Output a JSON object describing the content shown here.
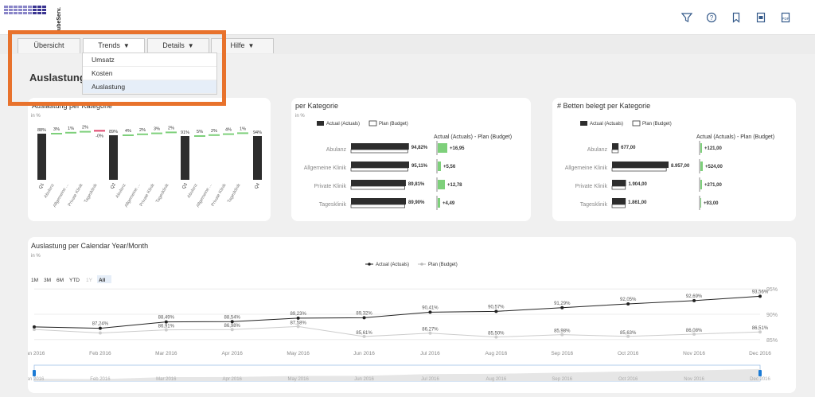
{
  "app": {
    "logo_text": "ubeServ."
  },
  "tabs": [
    {
      "label": "Übersicht"
    },
    {
      "label": "Trends"
    },
    {
      "label": "Details"
    },
    {
      "label": "Hilfe"
    }
  ],
  "dropdown": {
    "items": [
      "Umsatz",
      "Kosten",
      "Auslastung"
    ],
    "selected": "Auslastung"
  },
  "page": {
    "title": "Auslastungsa"
  },
  "cards": {
    "left": {
      "title": "Auslastung per Kategorie",
      "unit": "in %",
      "bar_labels": [
        "88%",
        "89%",
        "91%",
        "94%"
      ],
      "quarters": [
        "Q1",
        "Q2",
        "Q3",
        "Q4"
      ],
      "steps": [
        [
          "3%",
          "1%",
          "2%",
          "-0%"
        ],
        [
          "4%",
          "2%",
          "3%",
          "2%"
        ],
        [
          "5%",
          "2%",
          "4%",
          "1%"
        ]
      ],
      "categories": [
        "Abulanz",
        "Allgemeine ...",
        "Private Klinik",
        "Tagesklinik"
      ]
    },
    "middle": {
      "title": "per Kategorie",
      "unit": "in %",
      "legend": [
        "Actual (Actuals)",
        "Plan (Budget)"
      ],
      "variance_title": "Actual (Actuals) - Plan (Budget)",
      "rows": [
        {
          "label": "Abulanz",
          "actual": 94.82,
          "value": "94,82%",
          "delta": "+16,95"
        },
        {
          "label": "Allgemeine Klinik",
          "actual": 95.11,
          "value": "95,11%",
          "delta": "+5,56"
        },
        {
          "label": "Private Klinik",
          "actual": 89.81,
          "value": "89,81%",
          "delta": "+12,78"
        },
        {
          "label": "Tagesklinik",
          "actual": 89.9,
          "value": "89,90%",
          "delta": "+4,49"
        }
      ]
    },
    "right": {
      "title": "# Betten belegt per Kategorie",
      "legend": [
        "Actual (Actuals)",
        "Plan (Budget)"
      ],
      "variance_title": "Actual (Actuals) - Plan (Budget)",
      "rows": [
        {
          "label": "Abulanz",
          "actual": 677,
          "value": "677,00",
          "delta": "+121,00"
        },
        {
          "label": "Allgemeine Klinik",
          "actual": 8957,
          "value": "8.957,00",
          "delta": "+524,00"
        },
        {
          "label": "Private Klinik",
          "actual": 1904,
          "value": "1.904,00",
          "delta": "+271,00"
        },
        {
          "label": "Tagesklinik",
          "actual": 1861,
          "value": "1.861,00",
          "delta": "+93,00"
        }
      ]
    }
  },
  "line_card": {
    "title": "Auslastung per Calendar Year/Month",
    "unit": "in %",
    "range_buttons": [
      "1M",
      "3M",
      "6M",
      "YTD",
      "1Y",
      "All"
    ],
    "active_range": "All"
  },
  "chart_data": {
    "type": "line",
    "x": [
      "Jan 2016",
      "Feb 2016",
      "Mar 2016",
      "Apr 2016",
      "May 2016",
      "Jun 2016",
      "Jul 2016",
      "Aug 2016",
      "Sep 2016",
      "Oct 2016",
      "Nov 2016",
      "Dec 2016"
    ],
    "series": [
      {
        "name": "Actual (Actuals)",
        "values": [
          87.5,
          87.24,
          88.49,
          88.54,
          89.23,
          89.32,
          90.41,
          90.57,
          91.29,
          92.05,
          92.69,
          93.56
        ],
        "labels": [
          "",
          "87,24%",
          "88,49%",
          "88,54%",
          "89,23%",
          "89,32%",
          "90,41%",
          "90,57%",
          "91,29%",
          "92,05%",
          "92,69%",
          "93,56%"
        ]
      },
      {
        "name": "Plan (Budget)",
        "values": [
          87.0,
          86.3,
          86.91,
          86.98,
          87.58,
          85.61,
          86.27,
          85.5,
          85.98,
          85.63,
          86.08,
          86.51
        ],
        "labels": [
          "",
          "",
          "86,91%",
          "86,98%",
          "87,58%",
          "85,61%",
          "86,27%",
          "85,50%",
          "85,98%",
          "85,63%",
          "86,08%",
          "86,51%"
        ]
      }
    ],
    "y_ticks": [
      "95%",
      "90%",
      "85%"
    ],
    "ylim": [
      84.5,
      95.5
    ]
  }
}
